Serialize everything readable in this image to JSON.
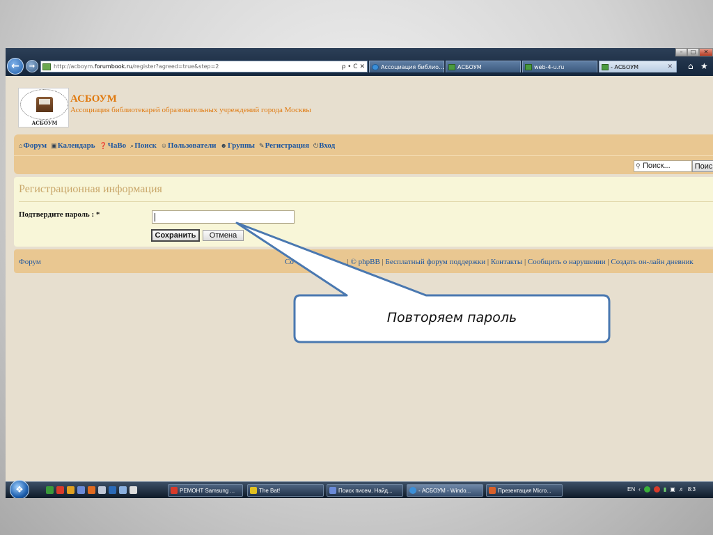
{
  "browser": {
    "url_prefix": "http://acboym.",
    "url_domain": "forumbook.ru",
    "url_path": "/register?agreed=true&step=2",
    "tools": "ρ • C ✕",
    "tabs": [
      {
        "label": "Ассоциация библио..."
      },
      {
        "label": "АСБОУМ"
      },
      {
        "label": "web-4-u.ru"
      },
      {
        "label": "- АСБОУМ"
      }
    ],
    "tab_close": "✕"
  },
  "site": {
    "logo_text": "АСБОУМ",
    "title": "АСБОУМ",
    "description": "Ассоциация библиотекарей образовательных учреждений города Москвы"
  },
  "nav": {
    "items": [
      {
        "icon": "⌂",
        "label": "Форум"
      },
      {
        "icon": "▣",
        "label": "Календарь"
      },
      {
        "icon": "❓",
        "label": "ЧаВо"
      },
      {
        "icon": "⌕",
        "label": "Поиск"
      },
      {
        "icon": "☺",
        "label": "Пользователи"
      },
      {
        "icon": "☻",
        "label": "Группы"
      },
      {
        "icon": "✎",
        "label": "Регистрация"
      },
      {
        "icon": "⏻",
        "label": "Вход"
      }
    ],
    "search_placeholder": "Поиск...",
    "search_button": "Поиск"
  },
  "registration": {
    "title": "Регистрационная информация",
    "confirm_label": "Подтвердите пароль : *",
    "save_label": "Сохранить",
    "cancel_label": "Отмена"
  },
  "footer": {
    "forum_link": "Форум",
    "links_prefix": "Со",
    "phpbb": "© phpBB",
    "free_forum": "Бесплатный форум поддержки",
    "contacts": "Контакты",
    "report": "Сообщить о нарушении",
    "create_diary": "Создать он-лайн дневник"
  },
  "taskbar": {
    "tasks": [
      {
        "label": "РЕМОНТ Samsung ..."
      },
      {
        "label": "The Bat!"
      },
      {
        "label": "Поиск писем. Найд..."
      },
      {
        "label": "- АСБОУМ - Windo..."
      },
      {
        "label": "Презентация Micro..."
      }
    ],
    "lang": "EN",
    "clock": "8:3"
  },
  "callout": {
    "text": "Повторяем пароль"
  }
}
